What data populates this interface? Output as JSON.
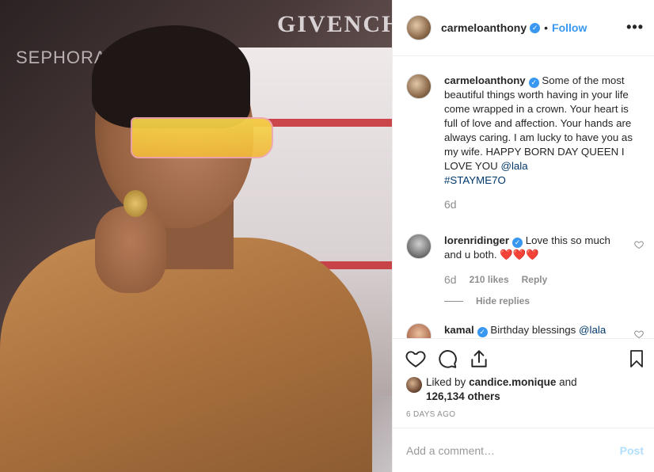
{
  "photo": {
    "sign": "GIVENCHY",
    "sign2": "SEPHORA"
  },
  "post_header": {
    "username": "carmeloanthony",
    "dot": "•",
    "follow_label": "Follow",
    "more_label": "•••"
  },
  "caption": {
    "username": "carmeloanthony",
    "text": "Some of the most beautiful things worth having in your life come wrapped in a crown. Your heart is full of love and affection. Your hands are always caring. I am lucky to have you as my wife. HAPPY BORN DAY QUEEN I LOVE YOU",
    "mention": "@lala",
    "hashtag": "#STAYME7O",
    "time": "6d"
  },
  "comments": [
    {
      "username": "lorenridinger",
      "text": "Love this so much and u both.",
      "emoji": "❤️❤️❤️",
      "time": "6d",
      "likes": "210 likes",
      "reply_label": "Reply",
      "hide_replies_label": "Hide replies"
    },
    {
      "username": "kamal",
      "text": "Birthday blessings",
      "mention": "@lala"
    }
  ],
  "likes": {
    "prefix": "Liked by",
    "user": "candice.monique",
    "suffix": "and",
    "count": "126,134 others"
  },
  "timestamp": "6 DAYS AGO",
  "add_comment": {
    "placeholder": "Add a comment…",
    "post_label": "Post"
  },
  "colors": {
    "accent": "#3897f0",
    "link": "#00376b",
    "muted": "#8e8e8e",
    "heart_red": "#ed4956"
  }
}
